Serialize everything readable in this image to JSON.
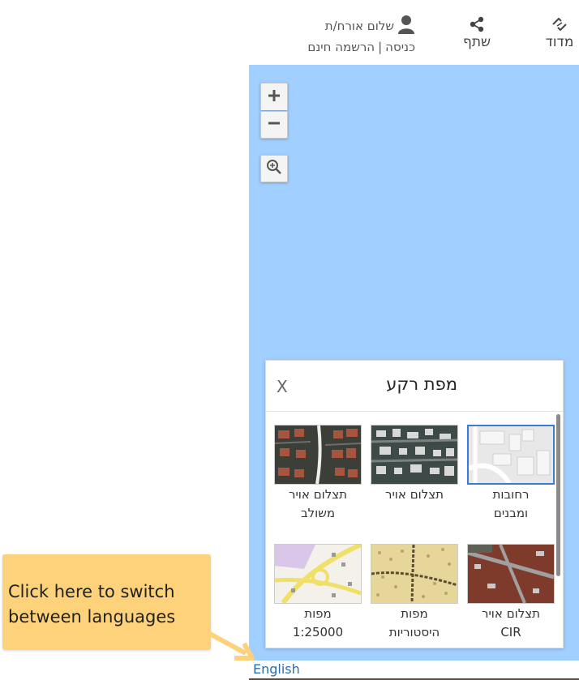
{
  "toolbar": {
    "measure_label": "מדוד",
    "share_label": "שתף",
    "greeting": "שלום אורח/ת",
    "login_label": "כניסה",
    "signup_label": "הרשמה חינם"
  },
  "map": {
    "background_color": "#a1cfff",
    "zoom_in_icon": "plus-icon",
    "zoom_out_icon": "minus-icon",
    "zoom_extent_icon": "zoom-magnifier-icon"
  },
  "basemap_panel": {
    "title": "מפת רקע",
    "close_label": "X",
    "tiles": [
      {
        "label_line1": "רחובות",
        "label_line2": "ומבנים",
        "selected": true
      },
      {
        "label_line1": "תצלום אויר",
        "label_line2": "",
        "selected": false
      },
      {
        "label_line1": "תצלום אויר",
        "label_line2": "משולב",
        "selected": false
      },
      {
        "label_line1": "תצלום אויר",
        "label_line2": "CIR",
        "selected": false
      },
      {
        "label_line1": "מפות",
        "label_line2": "היסטוריות",
        "selected": false
      },
      {
        "label_line1": "מפות",
        "label_line2": "1:25000",
        "selected": false
      }
    ]
  },
  "callout": {
    "line1": "Click here to switch",
    "line2": "between languages",
    "color": "#fdd27a"
  },
  "footer": {
    "language_link": "English"
  }
}
